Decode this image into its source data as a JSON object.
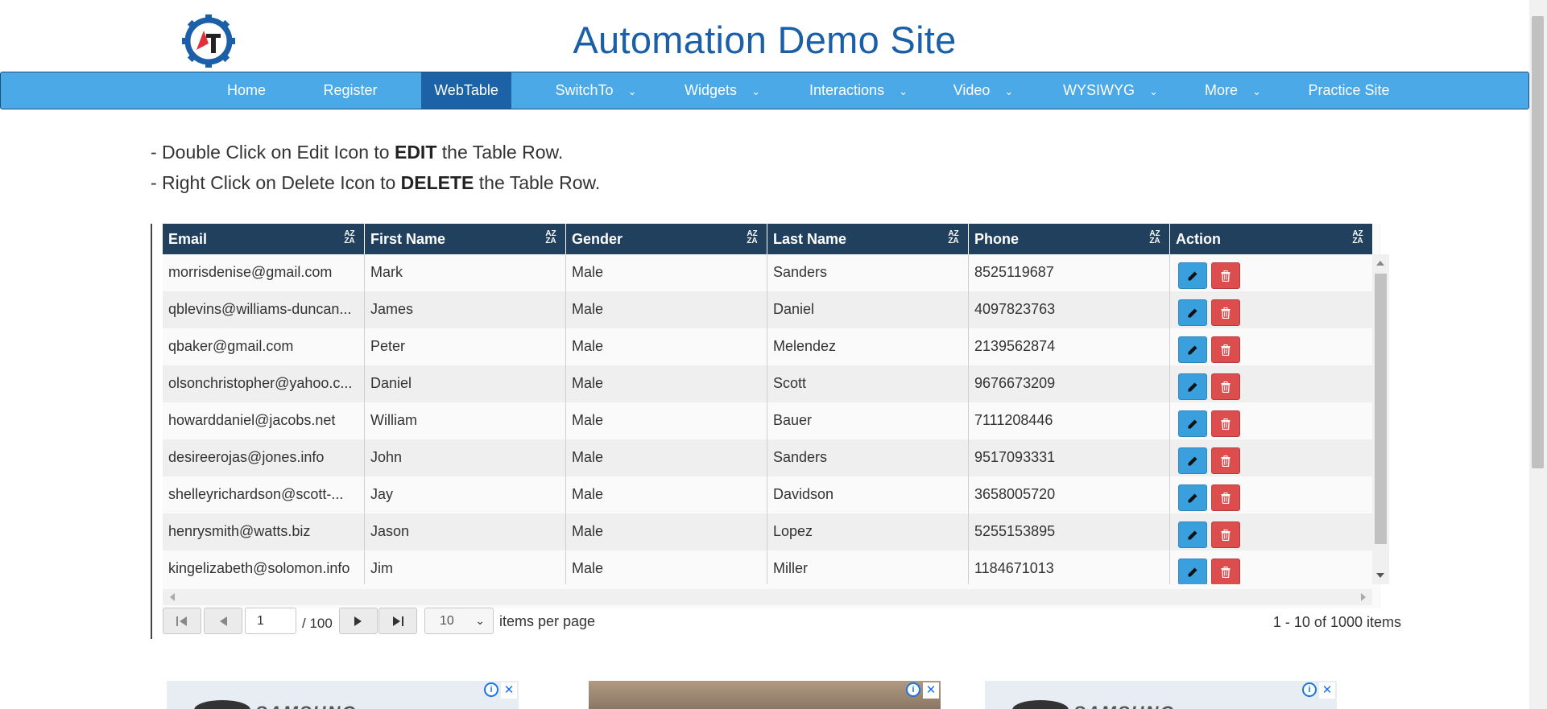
{
  "header": {
    "title": "Automation Demo Site",
    "logo_letters": "AT",
    "colors": {
      "title": "#1a5fa8",
      "nav_bg": "#4ba9e8",
      "nav_active": "#1b62a6",
      "table_header": "#21405e"
    }
  },
  "nav": {
    "items": [
      {
        "label": "Home"
      },
      {
        "label": "Register"
      },
      {
        "label": "WebTable"
      },
      {
        "label": "SwitchTo"
      },
      {
        "label": "Widgets"
      },
      {
        "label": "Interactions"
      },
      {
        "label": "Video"
      },
      {
        "label": "WYSIWYG"
      },
      {
        "label": "More"
      },
      {
        "label": "Practice Site"
      }
    ],
    "active": "WebTable"
  },
  "instructions": {
    "line1_pre": "- Double Click on Edit Icon to ",
    "line1_bold": "EDIT",
    "line1_post": " the Table Row.",
    "line2_pre": "- Right Click on Delete Icon to ",
    "line2_bold": "DELETE",
    "line2_post": " the Table Row."
  },
  "table": {
    "columns": [
      "Email",
      "First Name",
      "Gender",
      "Last Name",
      "Phone",
      "Action"
    ],
    "rows": [
      [
        "morrisdenise@gmail.com",
        "Mark",
        "Male",
        "Sanders",
        "8525119687"
      ],
      [
        "qblevins@williams-duncan...",
        "James",
        "Male",
        "Daniel",
        "4097823763"
      ],
      [
        "qbaker@gmail.com",
        "Peter",
        "Male",
        "Melendez",
        "2139562874"
      ],
      [
        "olsonchristopher@yahoo.c...",
        "Daniel",
        "Male",
        "Scott",
        "9676673209"
      ],
      [
        "howarddaniel@jacobs.net",
        "William",
        "Male",
        "Bauer",
        "7111208446"
      ],
      [
        "desireerojas@jones.info",
        "John",
        "Male",
        "Sanders",
        "9517093331"
      ],
      [
        "shelleyrichardson@scott-...",
        "Jay",
        "Male",
        "Davidson",
        "3658005720"
      ],
      [
        "henrysmith@watts.biz",
        "Jason",
        "Male",
        "Lopez",
        "5255153895"
      ],
      [
        "kingelizabeth@solomon.info",
        "Jim",
        "Male",
        "Miller",
        "1184671013"
      ]
    ],
    "edit_icon": "pencil-icon",
    "delete_icon": "trash-icon"
  },
  "pager": {
    "current_page": "1",
    "of_text": "/ 100",
    "page_size": "10",
    "items_per_page_label": "items per page",
    "range_text": "1 - 10 of 1000 items"
  },
  "ads": {
    "brand_text": "SAMSUNG"
  }
}
